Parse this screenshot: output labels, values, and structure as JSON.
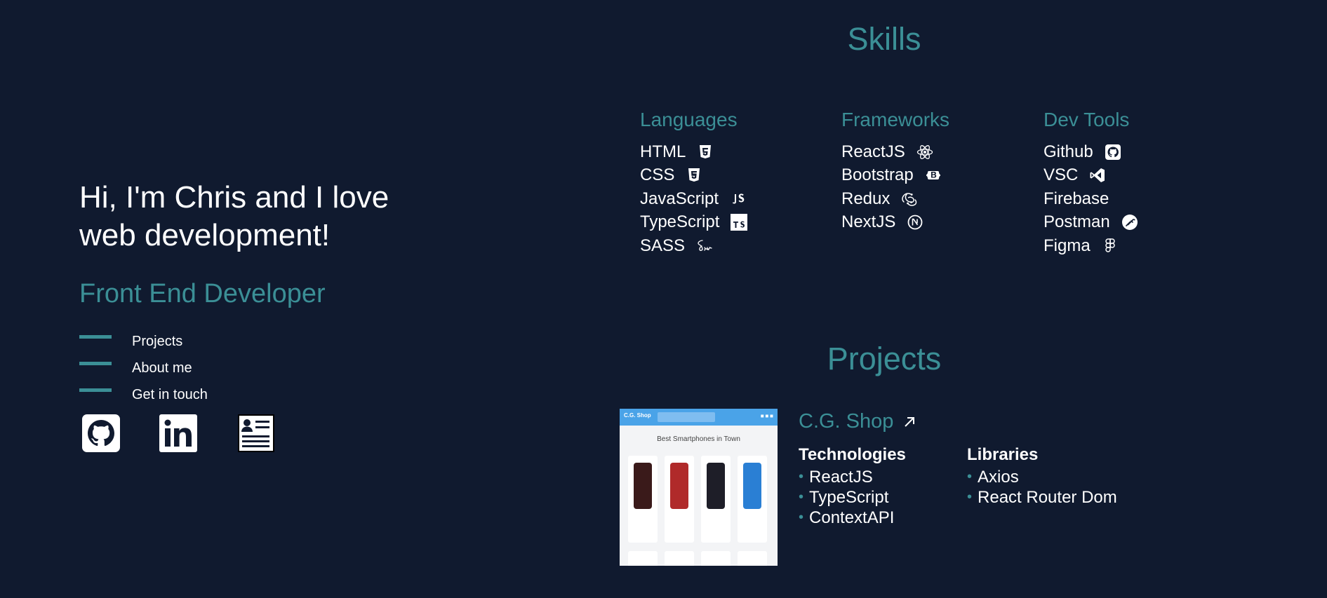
{
  "hero": {
    "greeting_line1": "Hi, I'm Chris and I love",
    "greeting_line2": "web development!",
    "role": "Front End Developer"
  },
  "nav": {
    "items": [
      {
        "label": "Projects"
      },
      {
        "label": "About me"
      },
      {
        "label": "Get in touch"
      }
    ]
  },
  "socials": [
    {
      "icon": "github-icon"
    },
    {
      "icon": "linkedin-icon"
    },
    {
      "icon": "resume-icon"
    }
  ],
  "skills": {
    "title": "Skills",
    "columns": [
      {
        "heading": "Languages",
        "items": [
          {
            "label": "HTML",
            "icon": "html5-icon"
          },
          {
            "label": "CSS",
            "icon": "css3-icon"
          },
          {
            "label": "JavaScript",
            "icon": "javascript-icon"
          },
          {
            "label": "TypeScript",
            "icon": "typescript-icon"
          },
          {
            "label": "SASS",
            "icon": "sass-icon"
          }
        ]
      },
      {
        "heading": "Frameworks",
        "items": [
          {
            "label": "ReactJS",
            "icon": "react-icon"
          },
          {
            "label": "Bootstrap",
            "icon": "bootstrap-icon"
          },
          {
            "label": "Redux",
            "icon": "redux-icon"
          },
          {
            "label": "NextJS",
            "icon": "nextjs-icon"
          }
        ]
      },
      {
        "heading": "Dev Tools",
        "items": [
          {
            "label": "Github",
            "icon": "github-icon"
          },
          {
            "label": "VSC",
            "icon": "vscode-icon"
          },
          {
            "label": "Firebase",
            "icon": ""
          },
          {
            "label": "Postman",
            "icon": "postman-icon"
          },
          {
            "label": "Figma",
            "icon": "figma-icon"
          }
        ]
      }
    ]
  },
  "projects": {
    "title": "Projects",
    "items": [
      {
        "name": "C.G. Shop",
        "thumbnail": {
          "logo": "C.G. Shop",
          "heading": "Best Smartphones in Town"
        },
        "technologies_heading": "Technologies",
        "technologies": [
          "ReactJS",
          "TypeScript",
          "ContextAPI"
        ],
        "libraries_heading": "Libraries",
        "libraries": [
          "Axios",
          "React Router Dom"
        ]
      }
    ]
  },
  "colors": {
    "background": "#101a2f",
    "accent": "#3b8f96",
    "text": "#ffffff"
  }
}
